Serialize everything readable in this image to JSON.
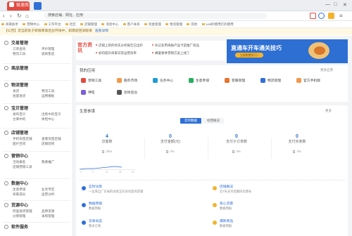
{
  "browser": {
    "tab_title": "极速商家版",
    "address": "搜索店铺、网址、应用",
    "colors": {
      "accent": "#e24b3f",
      "blue": "#2f6fd6"
    }
  },
  "bookmarks": [
    "商家助手",
    "营销中心",
    "工作平台",
    "社区",
    "店铺管理",
    "消息中心",
    "客户关系",
    "资金管理",
    "物流管理",
    "其他",
    "Led的使用灯的使用"
  ],
  "notice": {
    "text": "【公告】您当前处于新版商家后台环境中，如需退回旧版请",
    "link": "查看详情"
  },
  "sidebar": [
    {
      "title": "交易管理",
      "items": [
        "订单查询",
        "评价管理",
        "物流工具",
        "退款售后"
      ]
    },
    {
      "title": "商品管理",
      "items": []
    },
    {
      "title": "物流管理",
      "items": [
        "发货",
        "物流工具",
        "批量发货",
        "运费模板"
      ]
    },
    {
      "title": "宝贝管理",
      "items": [
        "发布宝贝",
        "出售中的宝贝",
        "仓库中的",
        "体检中心"
      ]
    },
    {
      "title": "店铺管理",
      "items": [
        "手机淘宝店铺",
        "查看淘宝店铺",
        "图片空间",
        "店铺装修"
      ]
    },
    {
      "title": "营销中心",
      "items": [
        "活动报名",
        "我要推广",
        "店铺营销工具"
      ]
    },
    {
      "title": "数据中心",
      "items": [
        "生意参谋",
        "业务专区",
        "商家成长",
        "运营分析"
      ]
    },
    {
      "title": "货源中心",
      "items": [
        "阿里进货管理",
        "品牌货源",
        "分销管理",
        "采购管理"
      ]
    },
    {
      "title": "软件服务",
      "items": []
    }
  ],
  "promo": {
    "brand": "官方资讯",
    "items": [
      "店铺上新的优先分析报告已出炉",
      "如何提升商家日常运营效率",
      "标记多用海报产品卡是推广商品",
      "蜂蜜春季营销方案上线了"
    ],
    "banner_title": "直通车开车通关技巧",
    "banner_btn": "立即免费学习 ›"
  },
  "apps": {
    "title": "我的应用",
    "more": "更多应用",
    "items": [
      {
        "label": "营销工具",
        "color": "#e24b3f"
      },
      {
        "label": "服务市场",
        "color": "#f2994a"
      },
      {
        "label": "任务中心",
        "color": "#1f9bd8"
      },
      {
        "label": "生意参谋",
        "color": "#27ae60"
      },
      {
        "label": "客服管理",
        "color": "#e8742d"
      },
      {
        "label": "物流管理",
        "color": "#2f6fd6"
      },
      {
        "label": "官方手机版",
        "color": "#f2994a"
      },
      {
        "label": "神笔",
        "color": "#7b5ed6"
      },
      {
        "label": "装修后台",
        "color": "#555555"
      }
    ]
  },
  "data": {
    "title": "生意参谋",
    "more": "更多",
    "tab_realtime": "实时数据",
    "tab_period": "经营概况",
    "metrics": [
      {
        "value": "4",
        "label": "访客数",
        "pct": "25%"
      },
      {
        "value": "0",
        "label": "支付金额(元)",
        "pct": "0%"
      },
      {
        "value": "0",
        "label": "支付子订单数",
        "pct": "0%"
      },
      {
        "value": "0",
        "label": "支付买家数",
        "pct": "0%"
      }
    ],
    "chart_ticks": [
      "0",
      "6",
      "12",
      "18",
      "23"
    ],
    "feed": [
      {
        "title": "实时访客",
        "sub": "一位来自广东省的访客正在访问您的店铺",
        "color": "#2f6fd6"
      },
      {
        "title": "店铺概况",
        "sub": "近7天支付金额同比增长",
        "color": "#f2b32d"
      },
      {
        "title": "数据周报",
        "sub": "数据周报",
        "color": "#2f6fd6"
      },
      {
        "title": "核心流量",
        "sub": "数据周报",
        "color": "#f2b32d"
      },
      {
        "title": "竞争动态",
        "sub": "暂未订阅",
        "color": "#2f6fd6"
      },
      {
        "title": "爆款商品",
        "sub": "数据周报",
        "color": "#f2b32d"
      }
    ]
  }
}
